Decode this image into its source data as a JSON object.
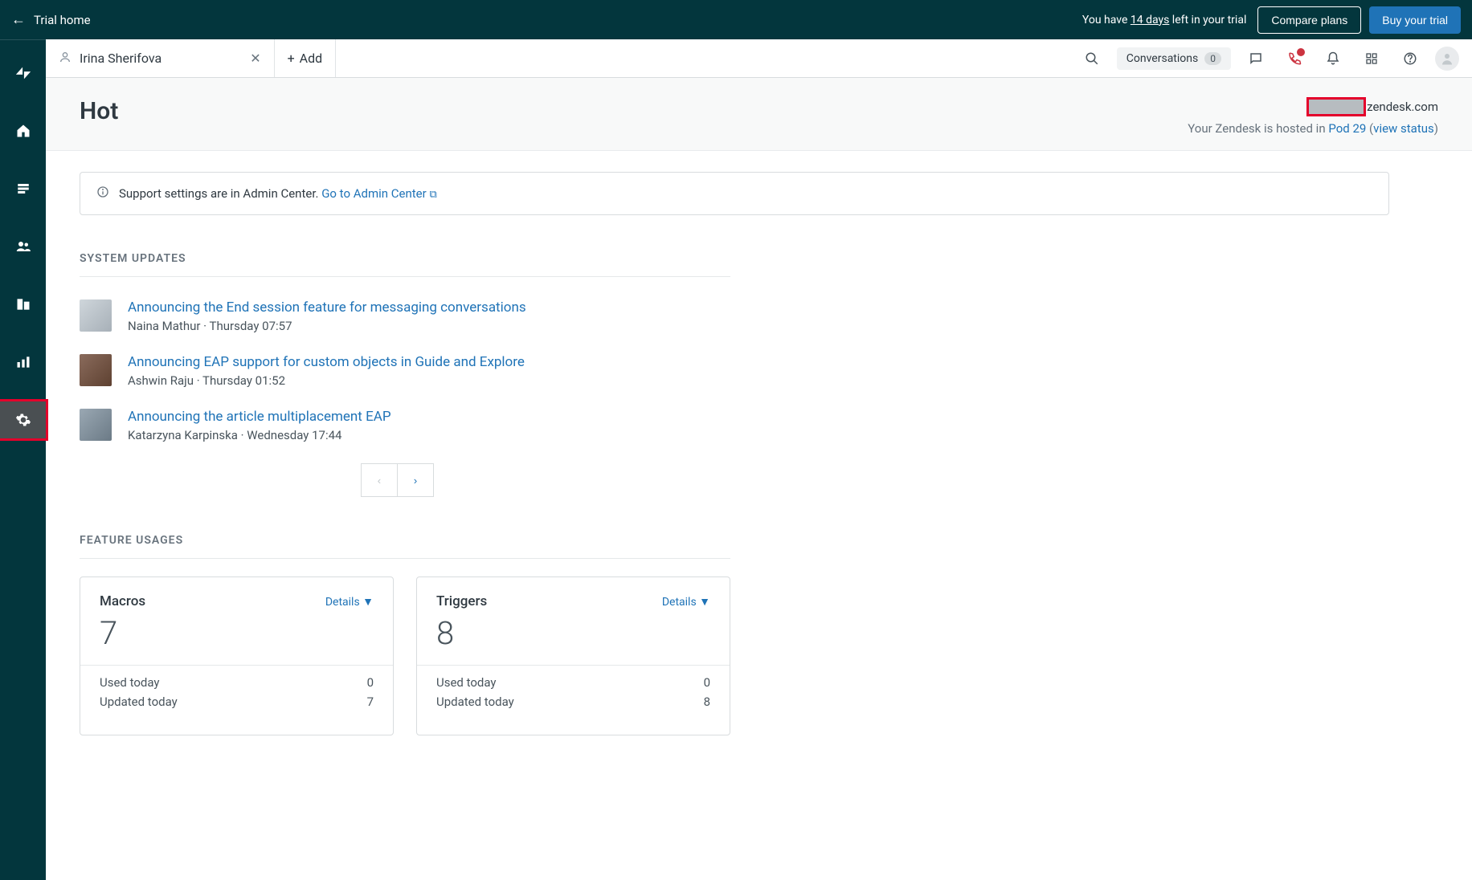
{
  "topbar": {
    "back_label": "Trial home",
    "trial_prefix": "You have ",
    "trial_days": "14 days",
    "trial_suffix": " left in your trial",
    "compare_label": "Compare plans",
    "buy_label": "Buy your trial"
  },
  "tabs": {
    "user_name": "Irina Sherifova",
    "add_label": "Add"
  },
  "header_tools": {
    "conversations_label": "Conversations",
    "conversations_count": "0"
  },
  "page": {
    "title": "Hot",
    "domain_suffix": "zendesk.com",
    "hosted_prefix": "Your Zendesk is hosted in ",
    "pod": "Pod 29",
    "view_status": "view status"
  },
  "notice": {
    "text": "Support settings are in Admin Center. ",
    "link": "Go to Admin Center"
  },
  "sections": {
    "system_updates": "SYSTEM UPDATES",
    "feature_usages": "FEATURE USAGES"
  },
  "updates": [
    {
      "title": "Announcing the End session feature for messaging conversations",
      "meta": "Naina Mathur · Thursday 07:57"
    },
    {
      "title": "Announcing EAP support for custom objects in Guide and Explore",
      "meta": "Ashwin Raju · Thursday 01:52"
    },
    {
      "title": "Announcing the article multiplacement EAP",
      "meta": "Katarzyna Karpinska · Wednesday 17:44"
    }
  ],
  "cards": {
    "details_label": "Details ▼",
    "macros": {
      "name": "Macros",
      "count": "7",
      "used_label": "Used today",
      "used_value": "0",
      "updated_label": "Updated today",
      "updated_value": "7"
    },
    "triggers": {
      "name": "Triggers",
      "count": "8",
      "used_label": "Used today",
      "used_value": "0",
      "updated_label": "Updated today",
      "updated_value": "8"
    }
  }
}
